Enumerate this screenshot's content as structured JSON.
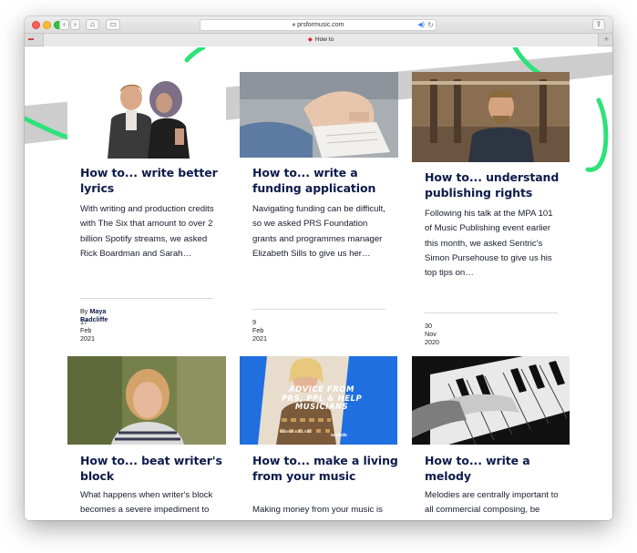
{
  "browser": {
    "url": "prsformusic.com",
    "tab_title": "How to",
    "icons": {
      "back": "‹",
      "forward": "›",
      "home": "⌂",
      "sidebar": "▭",
      "lock": "🔒",
      "audio": "🔊",
      "reload": "↻",
      "share": "⇪",
      "plus": "+"
    }
  },
  "cards": [
    {
      "title": "How to... write better lyrics",
      "description": "With writing and production credits with The Six that amount to over 2 billion Spotify streams, we asked Rick Boardman and Sarah…",
      "author_prefix": "By",
      "author": "Maya Radcliffe",
      "date": "17 Feb 2021"
    },
    {
      "title": "How to... write a funding application",
      "description": "Navigating funding can be difficult, so we asked PRS Foundation grants and programmes manager Elizabeth Sills to give us her…",
      "date": "9 Feb 2021"
    },
    {
      "title": "How to... understand publishing rights",
      "description": "Following his talk at the MPA 101 of Music Publishing event earlier this month, we asked Sentric's Simon Pursehouse to give us his top tips on…",
      "date": "30 Nov 2020"
    },
    {
      "title": "How to... beat writer's block",
      "description": "What happens when writer's block becomes a severe impediment to our"
    },
    {
      "title": "How to... make a living from your music",
      "description": "Making money from your music is key to sustaining",
      "image_text": "ADVICE FROM PRS, PPL & HELP MUSICIANS",
      "image_logo_left": "indiecentral LIVE",
      "image_logo_right": "sounds"
    },
    {
      "title": "How to... write a melody",
      "description": "Melodies are centrally important to all commercial composing, be"
    }
  ],
  "colors": {
    "title": "#0d1b4a",
    "accent_green": "#2ee27a",
    "gray_band": "#cdcdcd",
    "promo_blue": "#1f6fe0"
  }
}
